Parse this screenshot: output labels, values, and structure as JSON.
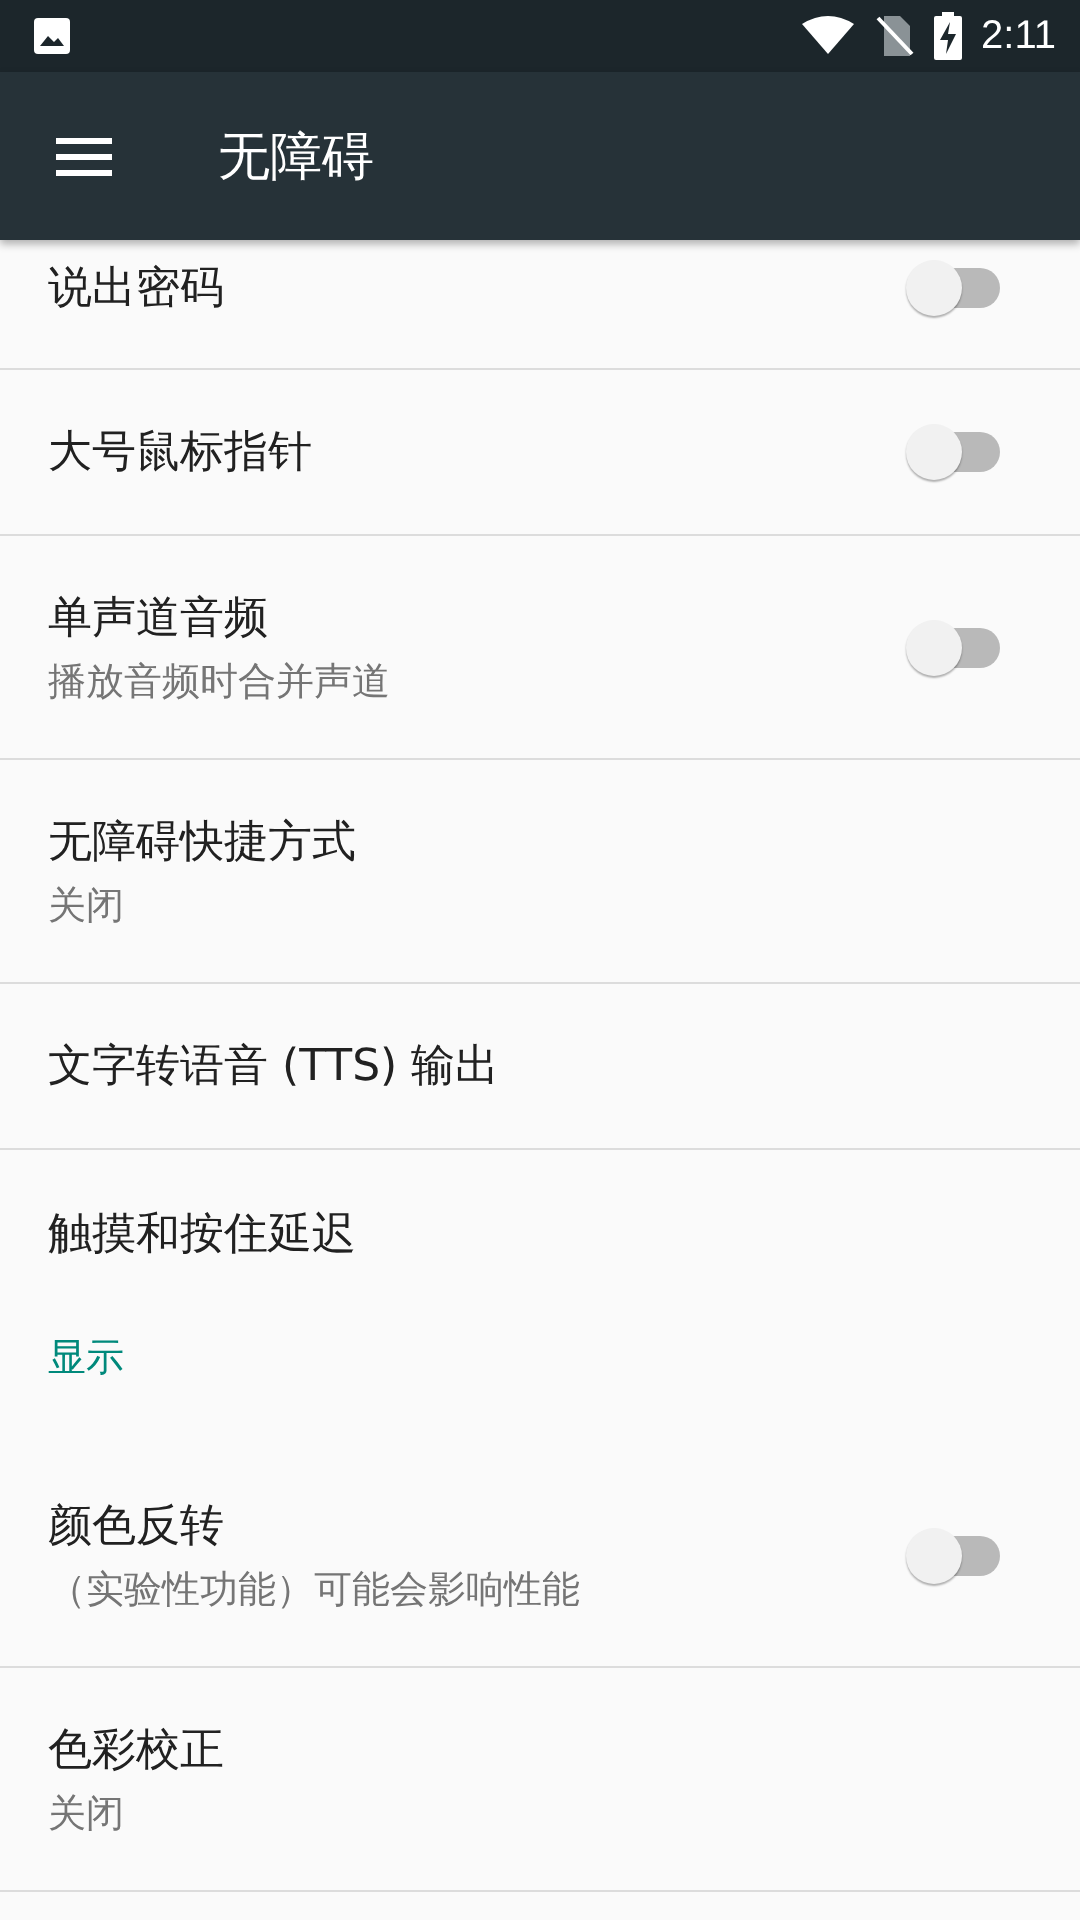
{
  "status_bar": {
    "time": "2:11"
  },
  "toolbar": {
    "title": "无障碍"
  },
  "items": [
    {
      "kind": "switch",
      "title": "说出密码",
      "on": false
    },
    {
      "kind": "switch",
      "title": "大号鼠标指针",
      "on": false
    },
    {
      "kind": "switch",
      "title": "单声道音频",
      "summary": "播放音频时合并声道",
      "on": false
    },
    {
      "kind": "plain",
      "title": "无障碍快捷方式",
      "summary": "关闭"
    },
    {
      "kind": "plain",
      "title": "文字转语音 (TTS) 输出"
    },
    {
      "kind": "plain",
      "title": "触摸和按住延迟"
    },
    {
      "kind": "category",
      "title": "显示"
    },
    {
      "kind": "switch",
      "title": "颜色反转",
      "summary": "（实验性功能）可能会影响性能",
      "on": false
    },
    {
      "kind": "plain",
      "title": "色彩校正",
      "summary": "关闭"
    }
  ]
}
